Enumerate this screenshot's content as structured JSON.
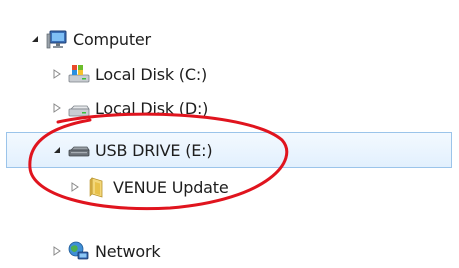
{
  "tree": {
    "items": [
      {
        "label": "Computer",
        "icon": "computer-icon",
        "expander": "expanded"
      },
      {
        "label": "Local Disk (C:)",
        "icon": "system-drive-icon",
        "expander": "collapsed"
      },
      {
        "label": "Local Disk (D:)",
        "icon": "hard-drive-icon",
        "expander": "collapsed"
      },
      {
        "label": "USB DRIVE (E:)",
        "icon": "usb-drive-icon",
        "expander": "expanded",
        "selected": true
      },
      {
        "label": "VENUE Update",
        "icon": "folder-icon",
        "expander": "collapsed"
      },
      {
        "label": "Network",
        "icon": "network-icon",
        "expander": "collapsed"
      }
    ]
  },
  "colors": {
    "selection_background": "#e2f0fd",
    "selection_border": "#9bc4ea",
    "annotation_circle": "#e0141e",
    "folder": "#e8c14a"
  }
}
